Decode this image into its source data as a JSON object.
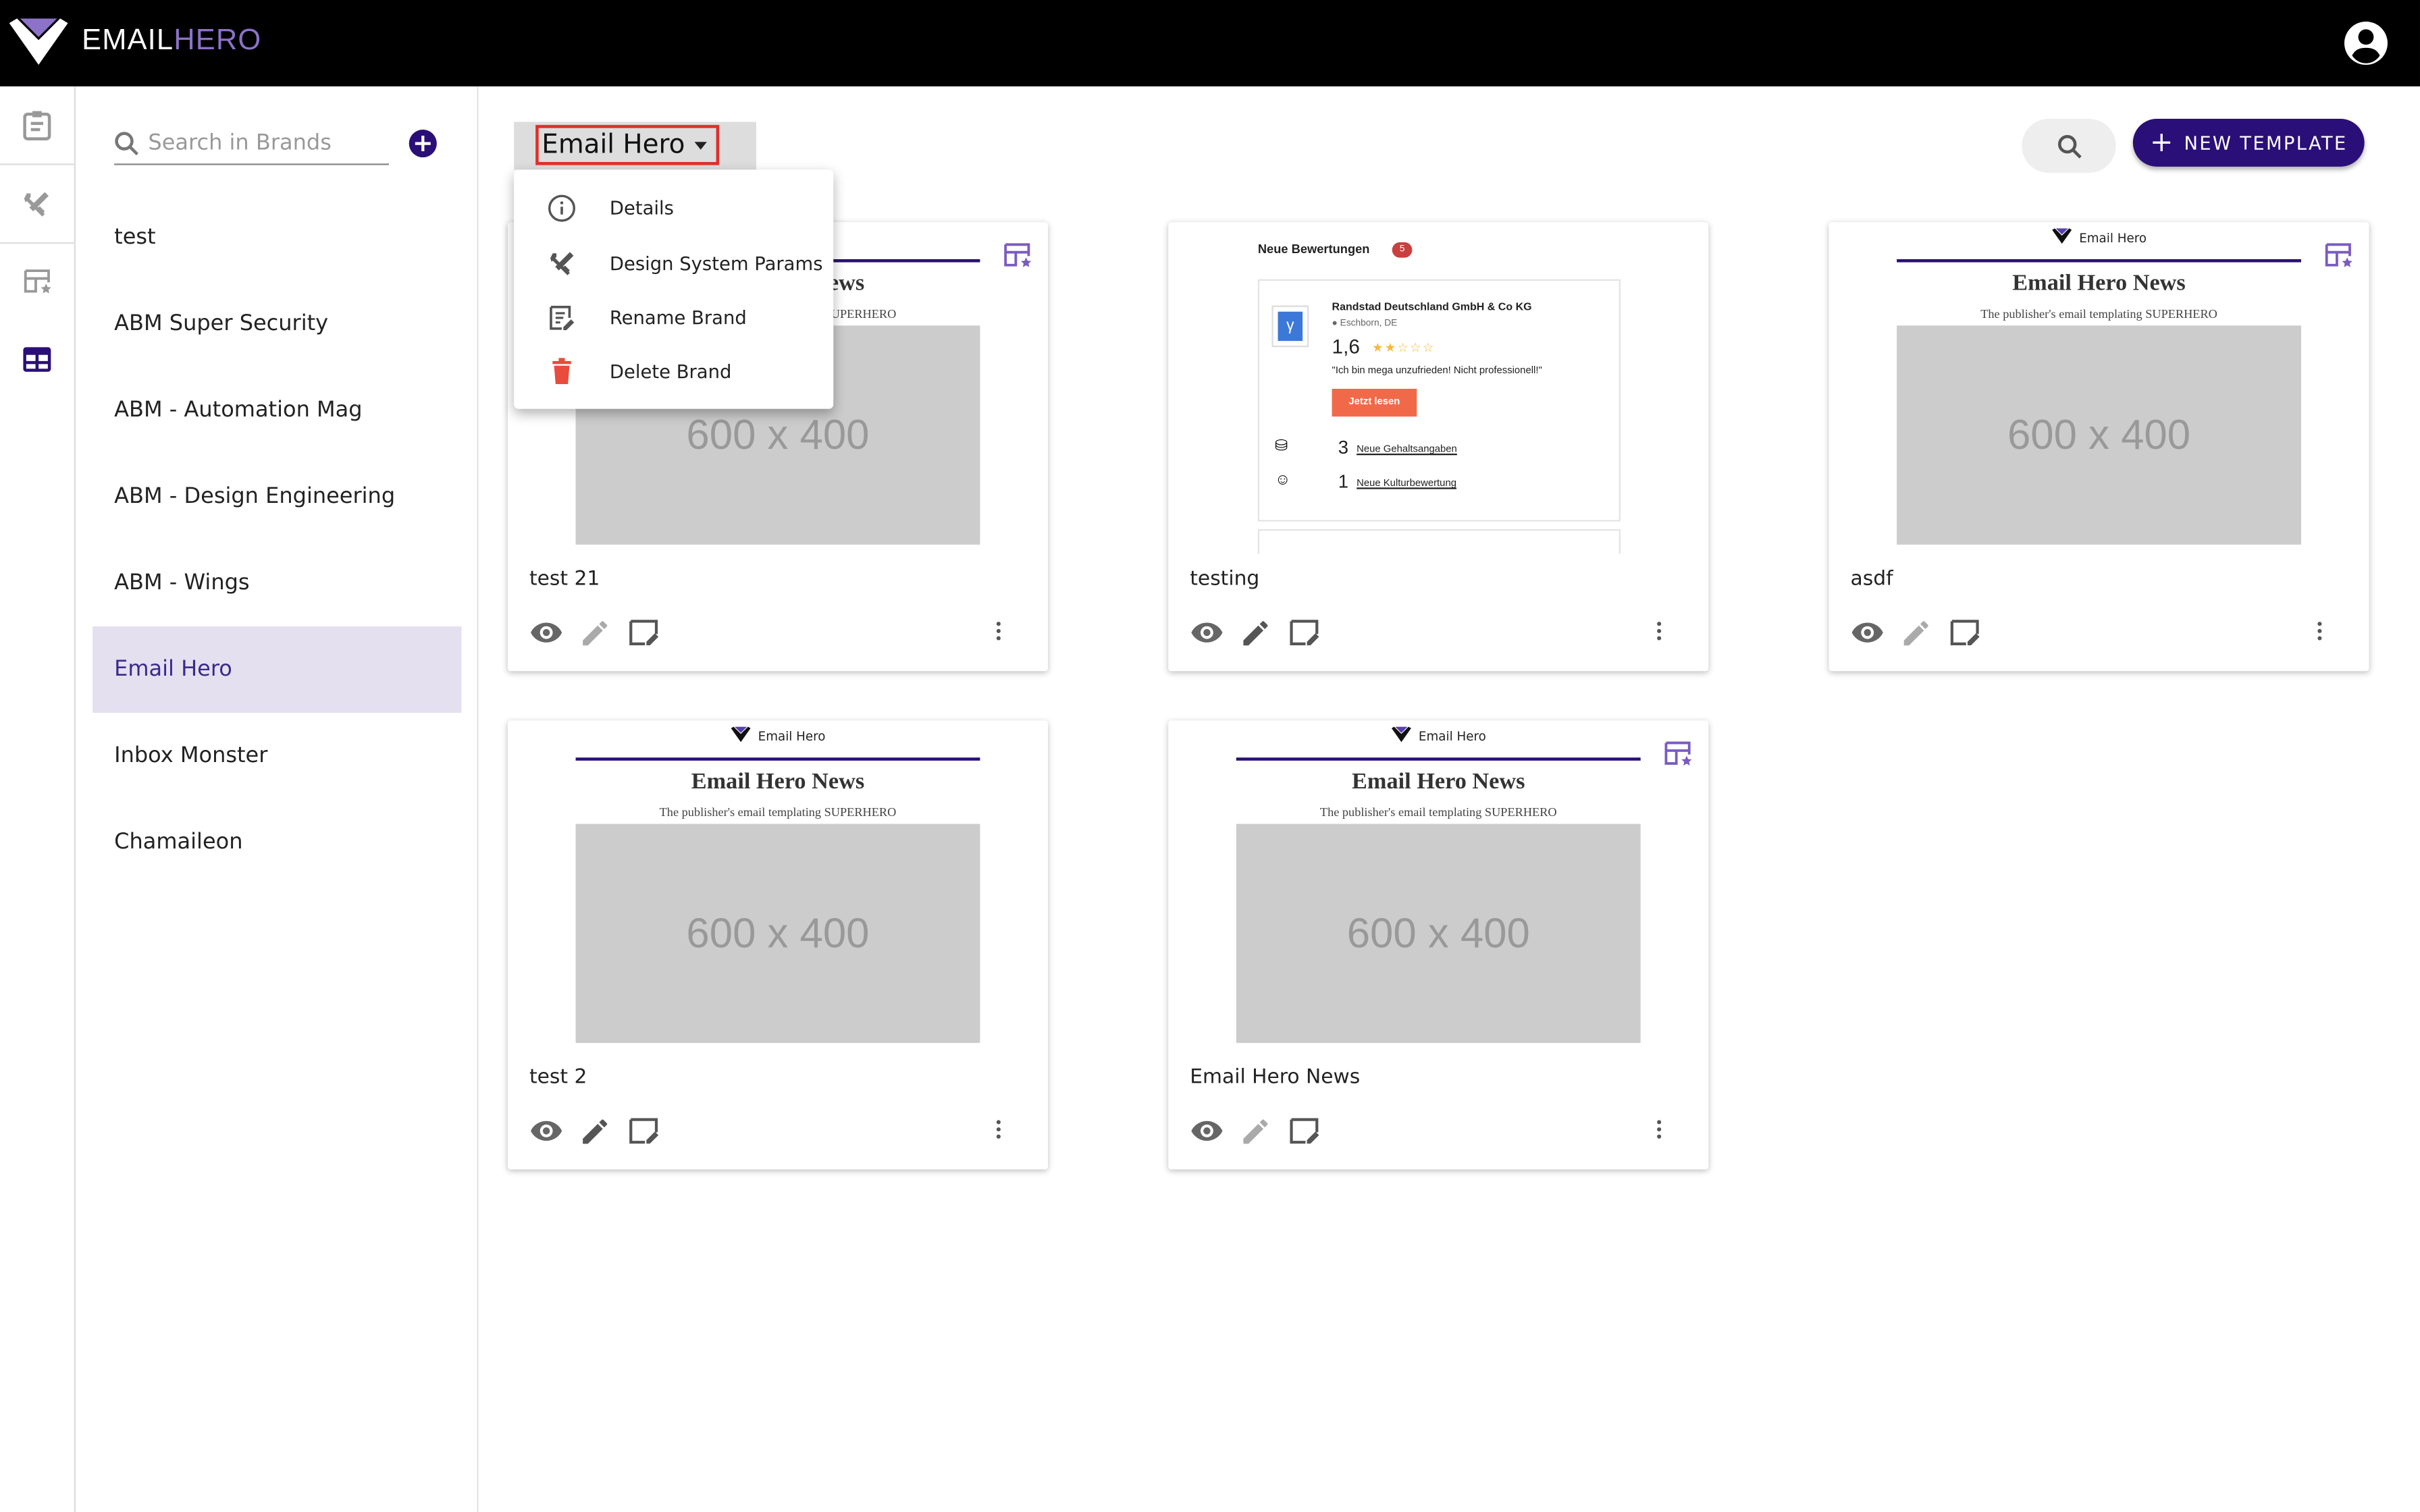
{
  "header": {
    "logo_text_1": "EMAIL",
    "logo_text_2": "HERO"
  },
  "rail": {
    "items": [
      "clipboard-icon",
      "design-tools-icon",
      "template-star-icon",
      "grid-icon"
    ],
    "active": "grid-icon"
  },
  "brands": {
    "search_placeholder": "Search in Brands",
    "items": [
      "test",
      "ABM Super Security",
      "ABM - Automation Mag",
      "ABM - Design Engineering",
      "ABM - Wings",
      "Email Hero",
      "Inbox Monster",
      "Chamaileon"
    ],
    "selected": "Email Hero"
  },
  "toolbar": {
    "brand_selector": "Email Hero",
    "new_template": "NEW TEMPLATE"
  },
  "menu": {
    "items": [
      {
        "label": "Details",
        "icon": "info-icon"
      },
      {
        "label": "Design System Params",
        "icon": "design-tools-icon"
      },
      {
        "label": "Rename Brand",
        "icon": "rename-icon"
      },
      {
        "label": "Delete Brand",
        "icon": "trash-icon"
      }
    ]
  },
  "preview": {
    "brand": "Email Hero",
    "title": "Email Hero News",
    "subtitle": "The publisher's email templating SUPERHERO",
    "placeholder": "600 x 400"
  },
  "review": {
    "heading": "Neue Bewertungen",
    "badge": "5",
    "company": "Randstad Deutschland GmbH & Co KG",
    "location": "Eschborn, DE",
    "rating": "1,6",
    "stars": 1.6,
    "quote": "\"Ich bin mega unzufrieden! Nicht professionell!\"",
    "cta": "Jetzt lesen",
    "stat1_num": "3",
    "stat1_label": "Neue Gehaltsangaben",
    "stat2_num": "1",
    "stat2_label": "Neue Kulturbewertung"
  },
  "cards": [
    {
      "title": "test 21"
    },
    {
      "title": "testing"
    },
    {
      "title": "asdf"
    },
    {
      "title": "test 2"
    },
    {
      "title": "Email Hero News"
    }
  ],
  "colors": {
    "primary": "#2a0f78",
    "selected_bg": "#e4e0f0",
    "accent": "#8c72c8",
    "danger": "#e0302a",
    "cta": "#f06a4a"
  }
}
